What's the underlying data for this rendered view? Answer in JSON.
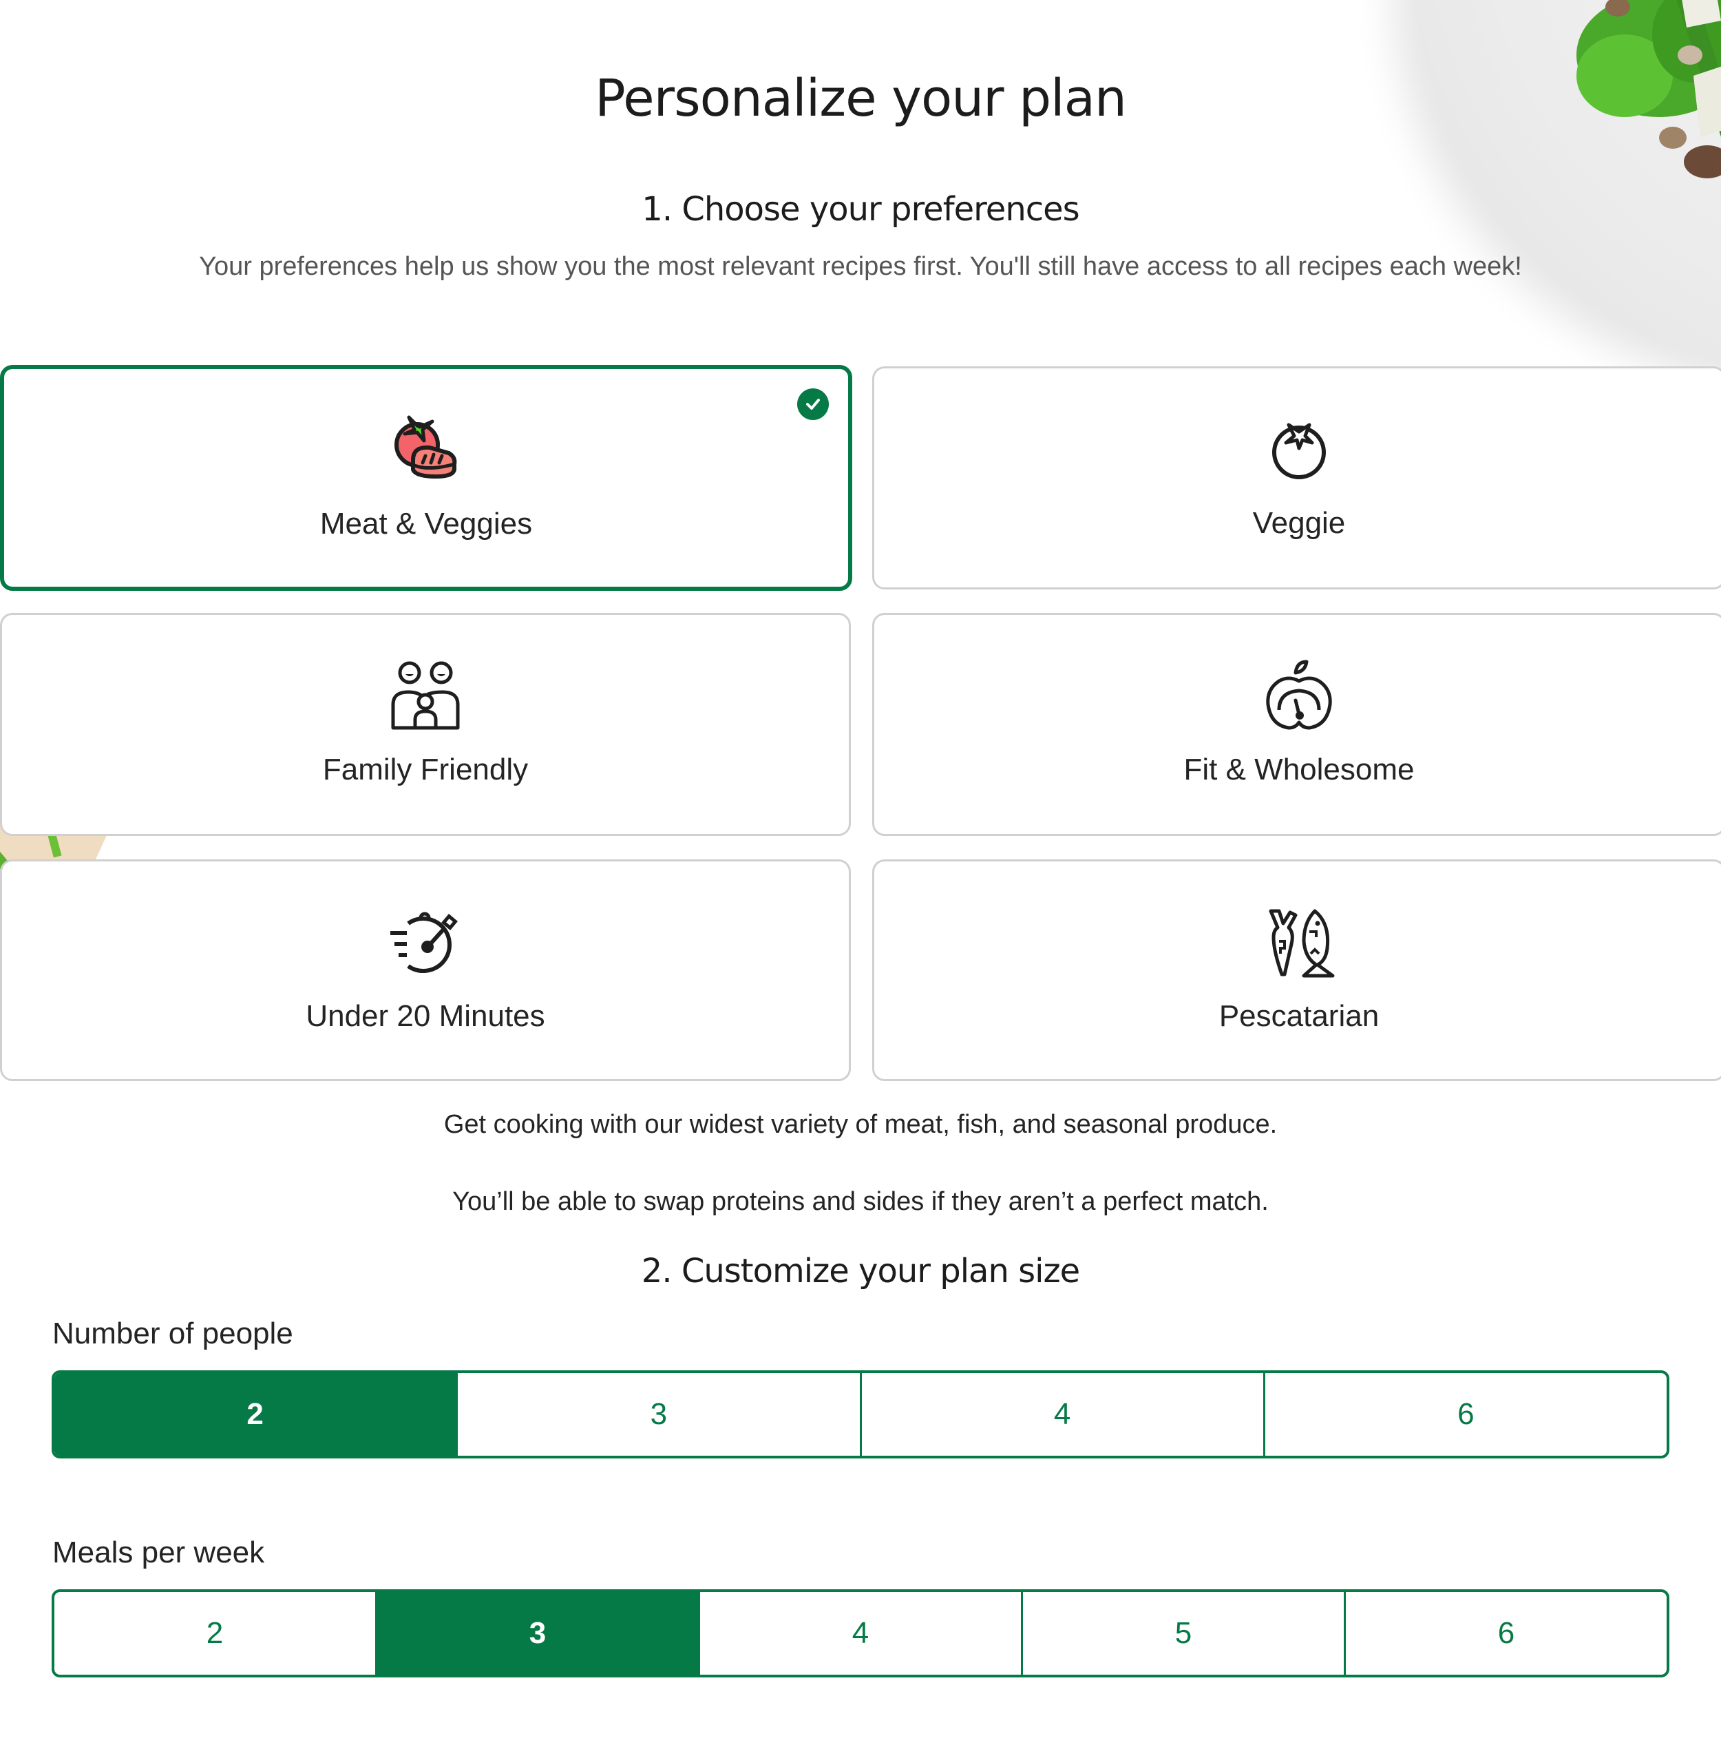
{
  "header": {
    "title": "Personalize your plan",
    "section1_title": "1. Choose your preferences",
    "section1_subtitle": "Your preferences help us show you the most relevant recipes first. You'll still have access to all recipes each week!"
  },
  "preferences": [
    {
      "label": "Meat & Veggies",
      "icon": "meat-veggies-icon",
      "selected": true
    },
    {
      "label": "Veggie",
      "icon": "tomato-icon",
      "selected": false
    },
    {
      "label": "Family Friendly",
      "icon": "family-icon",
      "selected": false
    },
    {
      "label": "Fit & Wholesome",
      "icon": "apple-gauge-icon",
      "selected": false
    },
    {
      "label": "Under 20 Minutes",
      "icon": "stopwatch-icon",
      "selected": false
    },
    {
      "label": "Pescatarian",
      "icon": "carrot-fish-icon",
      "selected": false
    }
  ],
  "preference_description": {
    "line1": "Get cooking with our widest variety of meat, fish, and seasonal produce.",
    "line2": "You’ll be able to swap proteins and sides if they aren’t a perfect match."
  },
  "plan_size": {
    "section2_title": "2. Customize your plan size",
    "people": {
      "label": "Number of people",
      "options": [
        "2",
        "3",
        "4",
        "6"
      ],
      "selected": "2"
    },
    "meals": {
      "label": "Meals per week",
      "options": [
        "2",
        "3",
        "4",
        "5",
        "6"
      ],
      "selected": "3"
    }
  },
  "colors": {
    "accent": "#067a46",
    "card_border": "#d0d0d0",
    "text": "#242424",
    "subtitle": "#555555"
  }
}
